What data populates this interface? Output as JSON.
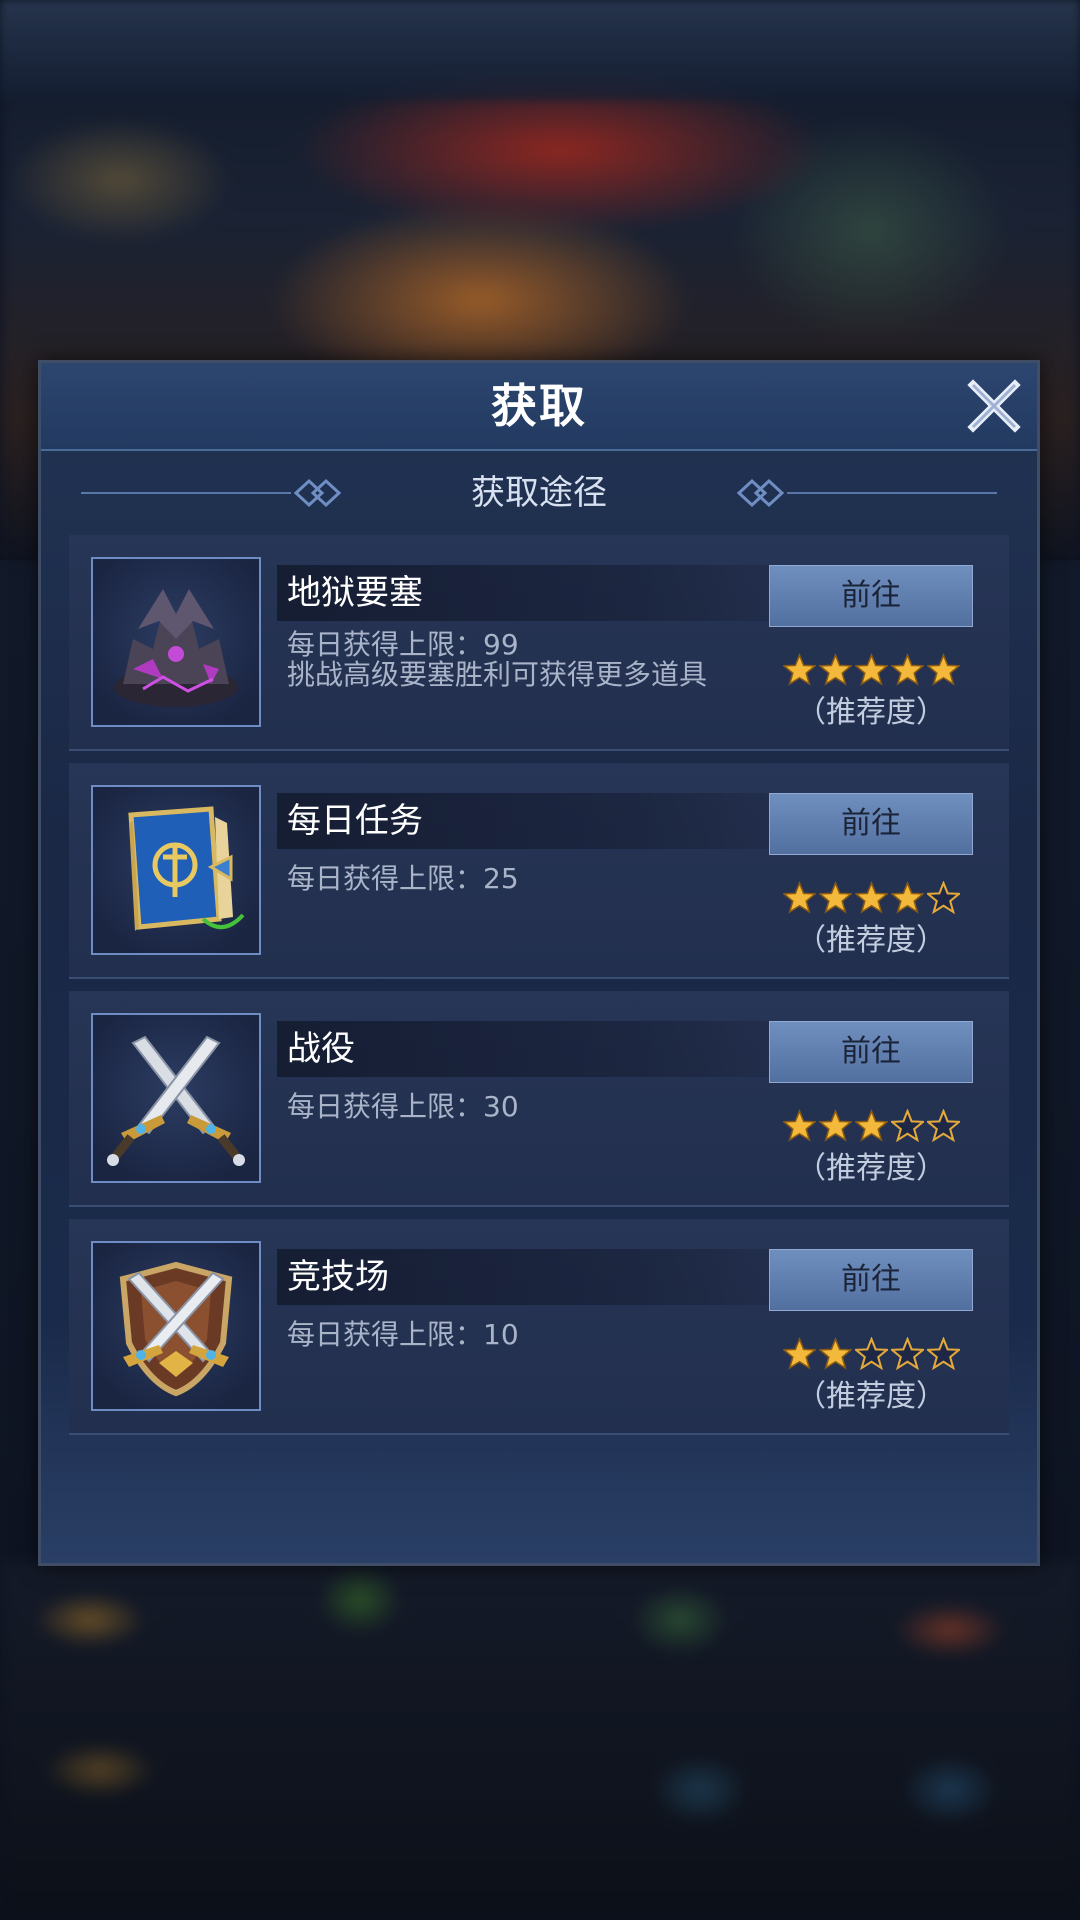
{
  "dialog": {
    "title": "获取",
    "subtitle": "获取途径"
  },
  "items": [
    {
      "icon": "fortress-icon",
      "name": "地狱要塞",
      "desc_lines": [
        "每日获得上限：99",
        "挑战高级要塞胜利可获得更多道具"
      ],
      "button_label": "前往",
      "stars": 5,
      "stars_max": 5,
      "rating_label": "（推荐度）"
    },
    {
      "icon": "book-icon",
      "name": "每日任务",
      "desc_lines": [
        "每日获得上限：25"
      ],
      "button_label": "前往",
      "stars": 4,
      "stars_max": 5,
      "rating_label": "（推荐度）"
    },
    {
      "icon": "crossed-swords-icon",
      "name": "战役",
      "desc_lines": [
        "每日获得上限：30"
      ],
      "button_label": "前往",
      "stars": 3,
      "stars_max": 5,
      "rating_label": "（推荐度）"
    },
    {
      "icon": "shield-swords-icon",
      "name": "竞技场",
      "desc_lines": [
        "每日获得上限：10"
      ],
      "button_label": "前往",
      "stars": 2,
      "stars_max": 5,
      "rating_label": "（推荐度）"
    }
  ],
  "colors": {
    "star_filled": "#f2b93b",
    "star_empty_outline": "#e3a93a",
    "button_bg": "#6585b6",
    "panel_bg": "#1a2846"
  }
}
